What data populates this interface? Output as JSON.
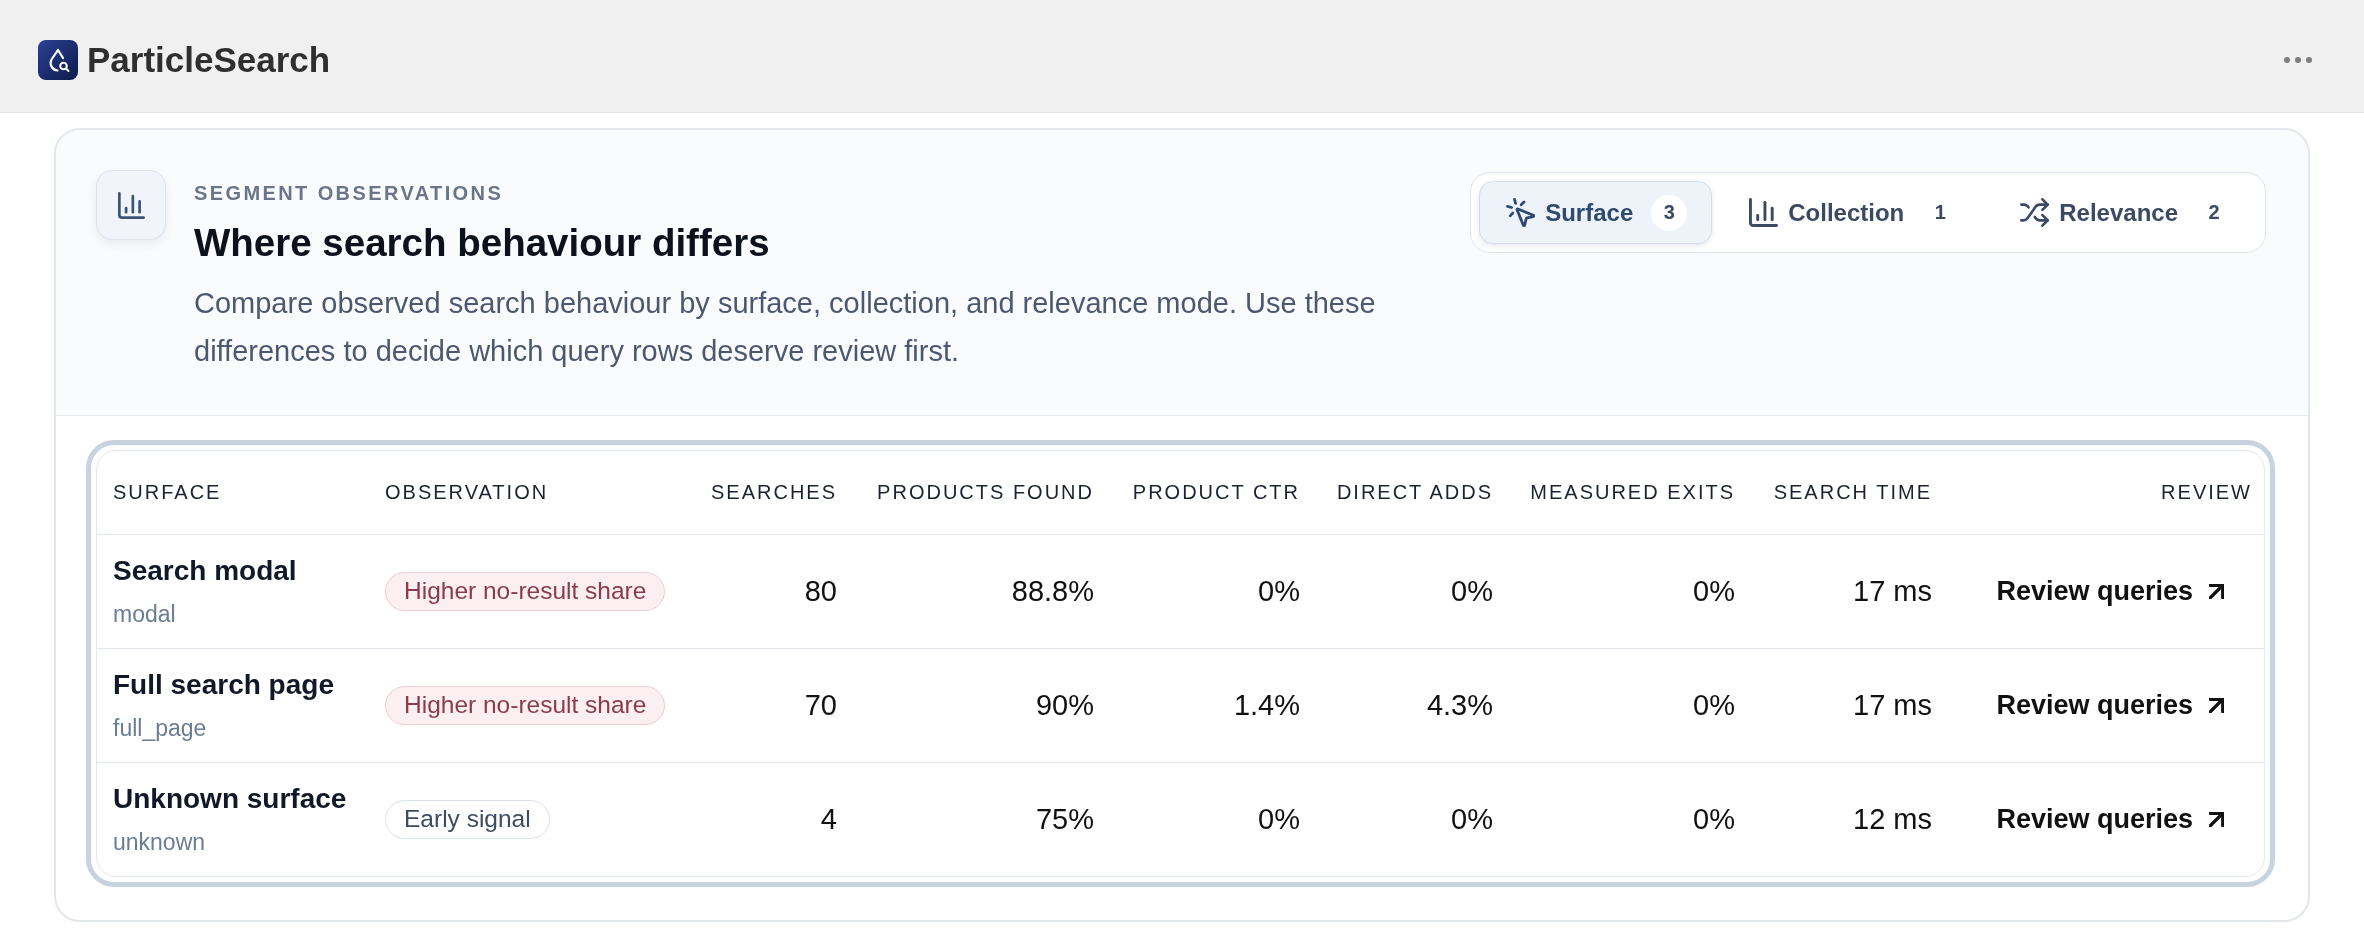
{
  "app": {
    "title": "ParticleSearch"
  },
  "panel": {
    "eyebrow": "SEGMENT OBSERVATIONS",
    "title": "Where search behaviour differs",
    "description": "Compare observed search behaviour by surface, collection, and relevance mode. Use these differences to decide which query rows deserve review first."
  },
  "tabs": [
    {
      "label": "Surface",
      "count": "3",
      "selected": true
    },
    {
      "label": "Collection",
      "count": "1",
      "selected": false
    },
    {
      "label": "Relevance",
      "count": "2",
      "selected": false
    }
  ],
  "table": {
    "columns": [
      "SURFACE",
      "OBSERVATION",
      "SEARCHES",
      "PRODUCTS FOUND",
      "PRODUCT CTR",
      "DIRECT ADDS",
      "MEASURED EXITS",
      "SEARCH TIME",
      "REVIEW"
    ],
    "rows": [
      {
        "surface": {
          "name": "Search modal",
          "key": "modal"
        },
        "observation": {
          "label": "Higher no-result share",
          "kind": "warning"
        },
        "searches": "80",
        "products_found": "88.8%",
        "product_ctr": "0%",
        "direct_adds": "0%",
        "measured_exits": "0%",
        "search_time": "17 ms",
        "review": "Review queries"
      },
      {
        "surface": {
          "name": "Full search page",
          "key": "full_page"
        },
        "observation": {
          "label": "Higher no-result share",
          "kind": "warning"
        },
        "searches": "70",
        "products_found": "90%",
        "product_ctr": "1.4%",
        "direct_adds": "4.3%",
        "measured_exits": "0%",
        "search_time": "17 ms",
        "review": "Review queries"
      },
      {
        "surface": {
          "name": "Unknown surface",
          "key": "unknown"
        },
        "observation": {
          "label": "Early signal",
          "kind": "neutral"
        },
        "searches": "4",
        "products_found": "75%",
        "product_ctr": "0%",
        "direct_adds": "0%",
        "measured_exits": "0%",
        "search_time": "12 ms",
        "review": "Review queries"
      }
    ]
  }
}
